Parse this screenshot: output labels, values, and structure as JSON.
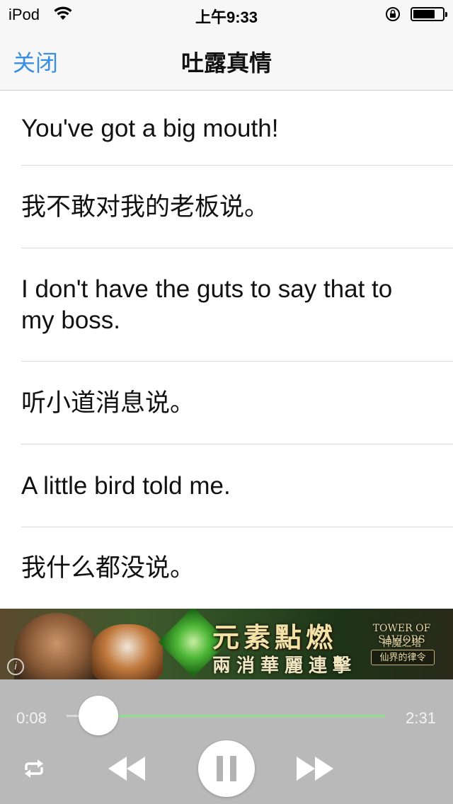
{
  "status_bar": {
    "carrier": "iPod",
    "time": "上午9:33",
    "battery_level": 0.75,
    "icons": [
      "wifi-icon",
      "rotation-lock-icon",
      "battery-icon"
    ]
  },
  "nav": {
    "close_label": "关闭",
    "title": "吐露真情"
  },
  "rows": [
    {
      "text": "You've got a big mouth!"
    },
    {
      "text": "我不敢对我的老板说。"
    },
    {
      "text": "I don't have the guts to say that to my boss."
    },
    {
      "text": "听小道消息说。"
    },
    {
      "text": "A little bird told me."
    },
    {
      "text": "我什么都没说。"
    }
  ],
  "ad": {
    "headline": "元素點燃",
    "subline": "兩消華麗連擊",
    "logo_en": "TOWER OF SAVIORS",
    "logo_zh": "神魔之塔",
    "logo_sub": "仙界的律令",
    "info_symbol": "i"
  },
  "player": {
    "elapsed": "0:08",
    "total": "2:31",
    "progress": 0.053,
    "state": "playing",
    "icons": [
      "repeat-icon",
      "rewind-icon",
      "pause-icon",
      "fast-forward-icon"
    ]
  },
  "colors": {
    "accent": "#3a8fe0",
    "player_bg": "#b9b9b9",
    "progress_track": "#8ee08e"
  }
}
